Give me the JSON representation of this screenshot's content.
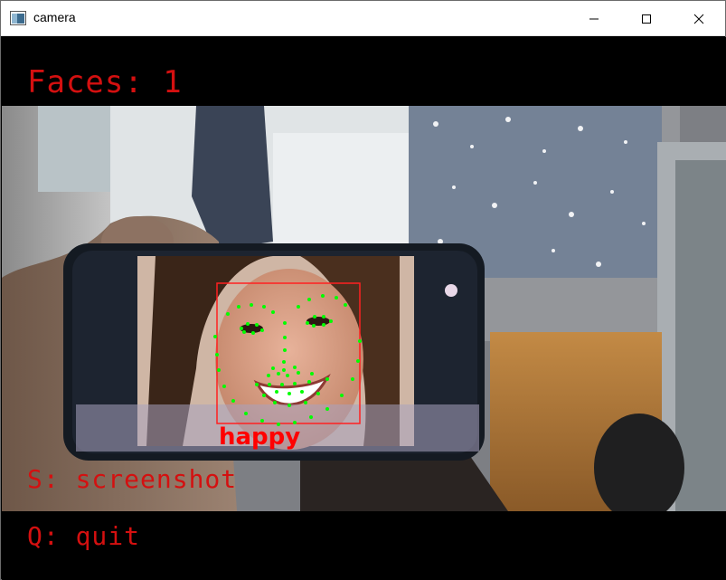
{
  "window": {
    "title": "camera",
    "controls": {
      "minimize": "minimize",
      "maximize": "maximize",
      "close": "close"
    }
  },
  "overlay": {
    "faces_count_text": "Faces: 1",
    "screenshot_hint": "S: screenshot",
    "quit_hint": "Q: quit",
    "emotion_label": "happy"
  },
  "colors": {
    "overlay_text": "#d41010",
    "face_box": "#ff2020",
    "landmarks": "#00ff00",
    "emotion": "#ff0000"
  }
}
